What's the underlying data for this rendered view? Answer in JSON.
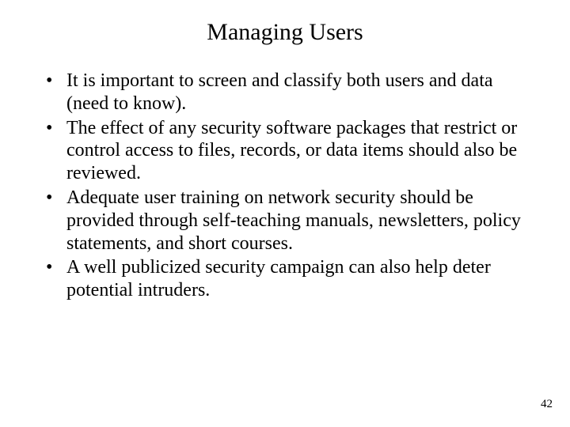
{
  "title": "Managing Users",
  "bullets": [
    "It is important to screen and classify both users and data (need to know).",
    "The effect of any security software packages that restrict or control access to files, records, or data items should also be reviewed.",
    "Adequate user training on network security should be provided through self-teaching manuals, newsletters, policy statements, and short courses.",
    "A well publicized security campaign can also help deter potential intruders."
  ],
  "page_number": "42"
}
